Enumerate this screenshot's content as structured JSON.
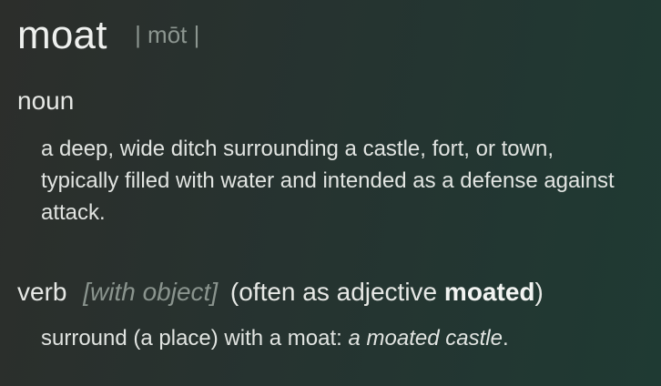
{
  "entry": {
    "headword": "moat",
    "pronunciation": "| mōt |"
  },
  "noun": {
    "part_of_speech": "noun",
    "definition": "a deep, wide ditch surrounding a castle, fort, or town, typically filled with water and intended as a defense against attack."
  },
  "verb": {
    "part_of_speech": "verb",
    "grammar_note": "[with object]",
    "usage_open": "(often as adjective ",
    "usage_bold": "moated",
    "usage_close": ")",
    "definition": "surround (a place) with a moat: ",
    "example": "a moated castle",
    "example_end": "."
  }
}
